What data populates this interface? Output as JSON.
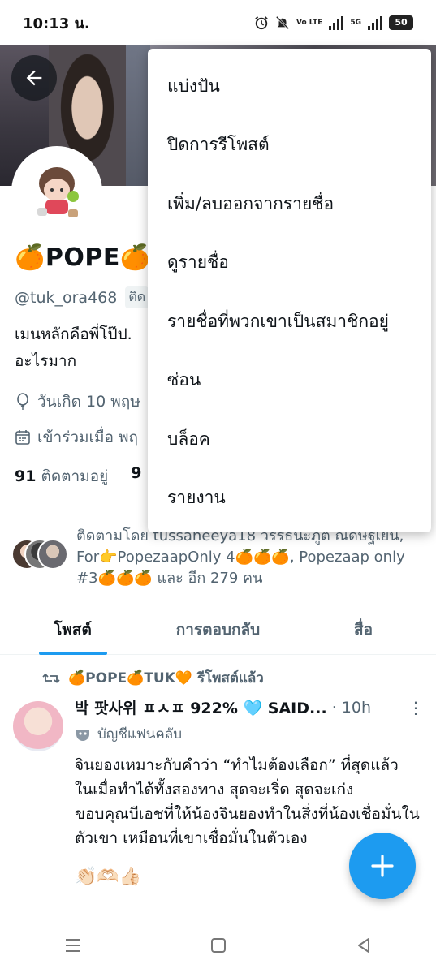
{
  "status_bar": {
    "time": "10:13 น.",
    "network_label": "5G",
    "volte_label": "Vo LTE",
    "battery": "50"
  },
  "profile": {
    "display_name": "🍊POPE🍊",
    "handle": "@tuk_ora468",
    "follows_you_label": "ติด",
    "bio": "เมนหลักคือพี่โป๊ป.\nอะไรมาก",
    "birthday": "วันเกิด 10 พฤษ",
    "joined": "เข้าร่วมเมื่อ พฤ",
    "following_count": "91",
    "following_label": "ติดตามอยู่",
    "followers_count_partial": "9"
  },
  "followed_by_text": "ติดตามโดย tussaneeya18 วรรธนะภูต ณดษฐเยน, For👉PopezaapOnly 4🍊🍊🍊, Popezaap only #3🍊🍊🍊 และ อีก 279 คน",
  "tabs": [
    {
      "label": "โพสต์",
      "active": true
    },
    {
      "label": "การตอบกลับ",
      "active": false
    },
    {
      "label": "สื่อ",
      "active": false
    }
  ],
  "post": {
    "repost_text": "🍊POPE🍊TUK🧡 รีโพสต์แล้ว",
    "author": "박 팟사위 ㅍㅅㅍ 922% 🩵 SAID...",
    "time": "· 10h",
    "fanclub_label": "บัญชีแฟนคลับ",
    "text": "จินยองเหมาะกับคำว่า “ทำไมต้องเลือก” ที่สุดแล้ว\nในเมื่อทำได้ทั้งสองทาง สุดจะเริ่ด สุดจะเก่ง\nขอบคุณบีเอชที่ให้น้องจินยองทำในสิ่งที่น้องเชื่อมั่นในตัวเขา เหมือนที่เขาเชื่อมั่นในตัวเอง",
    "emojis": "👏🏻🫶🏻👍🏻"
  },
  "menu": {
    "items": [
      "แบ่งปัน",
      "ปิดการรีโพสต์",
      "เพิ่ม/ลบออกจากรายชื่อ",
      "ดูรายชื่อ",
      "รายชื่อที่พวกเขาเป็นสมาชิกอยู่",
      "ซ่อน",
      "บล็อค",
      "รายงาน"
    ]
  },
  "colors": {
    "accent": "#1d9bf0",
    "secondary_text": "#536471",
    "primary_text": "#0f1419"
  },
  "icons": {
    "back": "arrow-left-icon",
    "fab": "plus-icon",
    "location": "balloon-icon",
    "calendar": "calendar-icon",
    "repost": "repost-icon",
    "more": "more-vertical-icon"
  }
}
